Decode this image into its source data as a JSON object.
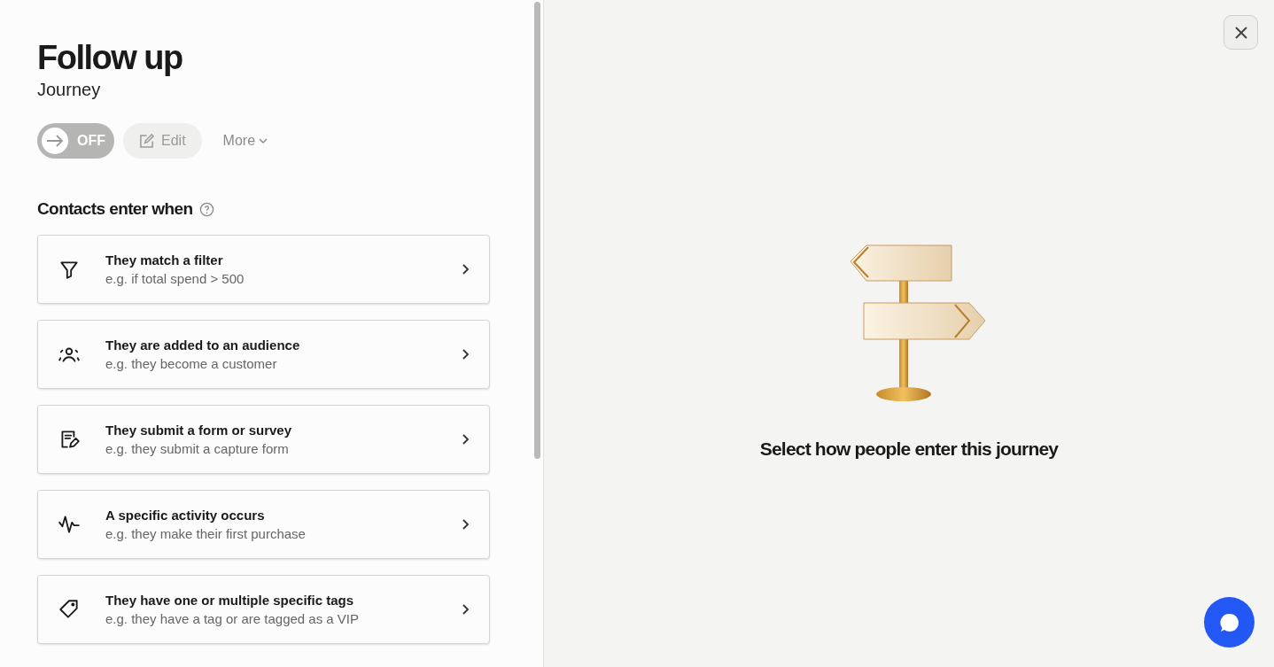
{
  "header": {
    "title": "Follow up",
    "subtitle": "Journey"
  },
  "toolbar": {
    "toggle": {
      "label": "OFF",
      "on": false
    },
    "edit": {
      "label": "Edit",
      "disabled": true
    },
    "more": {
      "label": "More"
    }
  },
  "section": {
    "title": "Contacts enter when"
  },
  "triggers": [
    {
      "kind": "filter",
      "title": "They match a filter",
      "example": "e.g. if total spend > 500"
    },
    {
      "kind": "audience",
      "title": "They are added to an audience",
      "example": "e.g. they become a customer"
    },
    {
      "kind": "form",
      "title": "They submit a form or survey",
      "example": "e.g. they submit a capture form"
    },
    {
      "kind": "activity",
      "title": "A specific activity occurs",
      "example": "e.g. they make their first purchase"
    },
    {
      "kind": "tag",
      "title": "They have one or multiple specific tags",
      "example": "e.g. they have a tag or are tagged as a VIP"
    }
  ],
  "empty_state": {
    "message": "Select how people enter this journey"
  }
}
